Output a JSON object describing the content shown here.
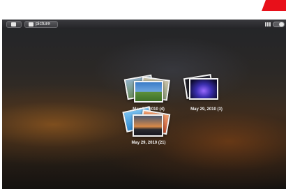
{
  "header": {
    "breadcrumb_folder": "picture",
    "accent_color": "#e8101a"
  },
  "icons": [
    "home-icon",
    "folder-icon",
    "grid-view-icon",
    "camera-mode-toggle"
  ],
  "albums": [
    {
      "label": "May 29, 2010 (4)"
    },
    {
      "label": "May 29, 2010 (3)"
    },
    {
      "label": "May 29, 2010 (21)"
    }
  ]
}
